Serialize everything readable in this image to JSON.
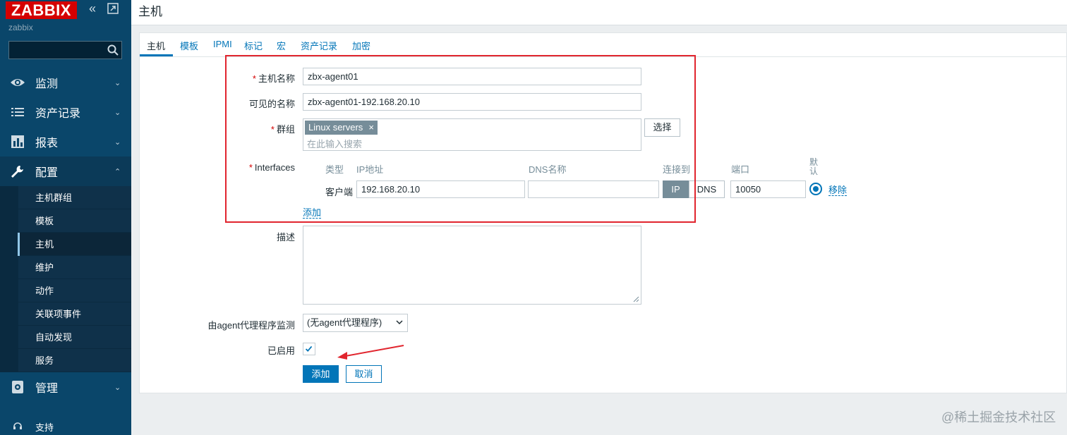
{
  "app": {
    "logo_text": "ZABBIX",
    "server_name": "zabbix",
    "search_placeholder": ""
  },
  "sidebar": {
    "items": [
      {
        "label": "监测",
        "icon": "eye-icon"
      },
      {
        "label": "资产记录",
        "icon": "list-icon"
      },
      {
        "label": "报表",
        "icon": "bar-chart-icon"
      },
      {
        "label": "配置",
        "icon": "wrench-icon"
      }
    ],
    "sub_items": [
      "主机群组",
      "模板",
      "主机",
      "维护",
      "动作",
      "关联项事件",
      "自动发现",
      "服务"
    ],
    "manage_label": "管理",
    "support_label": "支持"
  },
  "header": {
    "title": "主机"
  },
  "tabs": [
    "主机",
    "模板",
    "IPMI",
    "标记",
    "宏",
    "资产记录",
    "加密"
  ],
  "form": {
    "hostname_label": "主机名称",
    "hostname_value": "zbx-agent01",
    "visible_name_label": "可见的名称",
    "visible_name_value": "zbx-agent01-192.168.20.10",
    "groups_label": "群组",
    "group_chip": "Linux servers",
    "group_chip_remove": "×",
    "groups_placeholder": "在此输入搜索",
    "select_button": "选择",
    "interfaces_label": "Interfaces",
    "iface_headers": {
      "type": "类型",
      "ip": "IP地址",
      "dns": "DNS名称",
      "connect_to": "连接到",
      "port": "端口",
      "default": "默认"
    },
    "iface_row": {
      "type": "客户端",
      "ip": "192.168.20.10",
      "dns": "",
      "connect_ip": "IP",
      "connect_dns": "DNS",
      "port": "10050",
      "remove": "移除"
    },
    "add_interface_link": "添加",
    "description_label": "描述",
    "description_value": "",
    "proxy_label": "由agent代理程序监测",
    "proxy_value": "(无agent代理程序)",
    "enabled_label": "已启用",
    "enabled": true,
    "add_button": "添加",
    "cancel_button": "取消"
  },
  "watermark": "@稀土掘金技术社区",
  "colors": {
    "sidebar_bg": "#0a466a",
    "accent": "#0275b8",
    "logo_red": "#d40000",
    "annotation_red": "#e1252e"
  }
}
